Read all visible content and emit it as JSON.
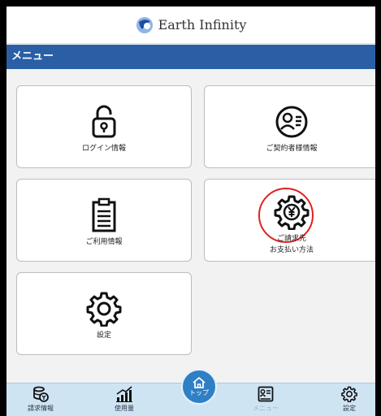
{
  "app": {
    "brand_name": "Earth Infinity"
  },
  "menubar": {
    "title": "メニュー"
  },
  "cards": [
    {
      "label": "ログイン情報",
      "icon": "lock-icon"
    },
    {
      "label": "ご契約者様情報",
      "icon": "user-card-icon"
    },
    {
      "label": "ご利用情報",
      "icon": "clipboard-icon"
    },
    {
      "label_line1": "ご請求先",
      "label_line2": "お支払い方法",
      "icon": "yen-gear-icon",
      "highlighted": true
    },
    {
      "label": "設定",
      "icon": "gear-icon"
    }
  ],
  "bottom_nav": {
    "items": [
      {
        "label": "請求情報",
        "icon": "billing-coin-icon"
      },
      {
        "label": "使用量",
        "icon": "usage-chart-icon"
      },
      {
        "label": "メニュー",
        "icon": "menu-card-icon",
        "active": true
      },
      {
        "label": "設定",
        "icon": "gear-icon"
      }
    ],
    "top_button": {
      "label": "トップ",
      "icon": "home-icon"
    }
  },
  "colors": {
    "menubar": "#2a5fa6",
    "nav_bg": "#cfe4f3",
    "top_button": "#2e7fc6",
    "highlight_ring": "#e02020"
  }
}
